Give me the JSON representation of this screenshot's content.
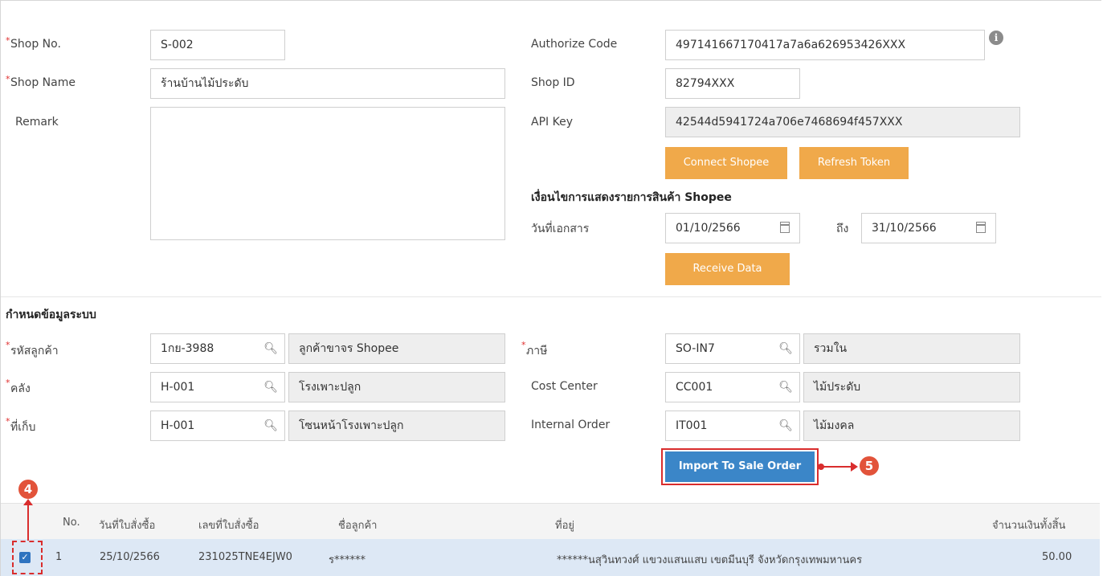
{
  "form": {
    "shop_no": {
      "label": "Shop No.",
      "value": "S-002"
    },
    "shop_name": {
      "label": "Shop Name",
      "value": "ร้านบ้านไม้ประดับ"
    },
    "remark": {
      "label": "Remark",
      "value": ""
    },
    "authorize_code": {
      "label": "Authorize Code",
      "value": "497141667170417a7a6a626953426XXX"
    },
    "shop_id": {
      "label": "Shop ID",
      "value": "82794XXX"
    },
    "api_key": {
      "label": "API Key",
      "value": "42544d5941724a706e7468694f457XXX"
    },
    "connect_button": "Connect Shopee",
    "refresh_button": "Refresh Token",
    "condition_title": "เงื่อนไขการแสดงรายการสินค้า Shopee",
    "doc_date_label": "วันที่เอกสาร",
    "date_from": "01/10/2566",
    "to_label": "ถึง",
    "date_to": "31/10/2566",
    "receive_button": "Receive Data"
  },
  "system": {
    "title": "กำหนดข้อมูลระบบ",
    "customer": {
      "label": "รหัสลูกค้า",
      "code": "1กย-3988",
      "name": "ลูกค้าขาจร Shopee"
    },
    "warehouse": {
      "label": "คลัง",
      "code": "H-001",
      "name": "โรงเพาะปลูก"
    },
    "location": {
      "label": "ที่เก็บ",
      "code": "H-001",
      "name": "โซนหน้าโรงเพาะปลูก"
    },
    "tax": {
      "label": "ภาษี",
      "code": "SO-IN7",
      "name": "รวมใน"
    },
    "cost_center": {
      "label": "Cost Center",
      "code": "CC001",
      "name": "ไม้ประดับ"
    },
    "internal_order": {
      "label": "Internal Order",
      "code": "IT001",
      "name": "ไม้มงคล"
    },
    "import_button": "Import To Sale Order"
  },
  "callouts": {
    "four": "4",
    "five": "5"
  },
  "table": {
    "headers": {
      "no": "No.",
      "order_date": "วันที่ใบสั่งซื้อ",
      "order_no": "เลขที่ใบสั่งซื้อ",
      "customer": "ชื่อลูกค้า",
      "address": "ที่อยู่",
      "total": "จำนวนเงินทั้งสิ้น"
    },
    "rows": [
      {
        "checked": true,
        "no": "1",
        "order_date": "25/10/2566",
        "order_no": "231025TNE4EJW0",
        "customer": "ร******",
        "address": "******นสุวินทวงศ์ แขวงแสนแสบ เขตมีนบุรี จังหวัดกรุงเทพมหานคร",
        "total": "50.00"
      }
    ]
  },
  "colors": {
    "orange": "#f0a94a",
    "blue": "#3b86c8",
    "red": "#e2533a",
    "row_highlight": "#dde8f5"
  }
}
